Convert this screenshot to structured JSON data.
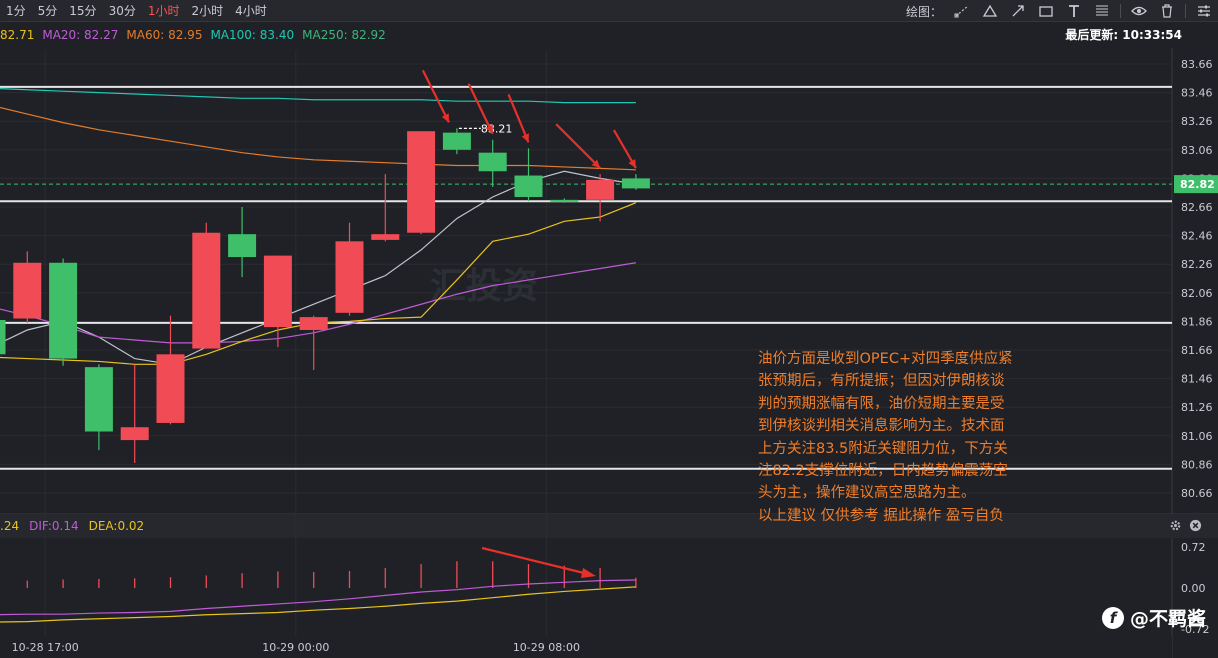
{
  "toolbar": {
    "timeframes": [
      "1分",
      "5分",
      "15分",
      "30分",
      "1小时",
      "2小时",
      "4小时"
    ],
    "active_index": 4,
    "draw_label": "绘图："
  },
  "ma_legend": [
    {
      "label": "82.71",
      "color": "#e8c31b"
    },
    {
      "label": "MA20: 82.27",
      "color": "#c05bd8"
    },
    {
      "label": "MA60: 82.95",
      "color": "#e57c2b"
    },
    {
      "label": "MA100: 83.40",
      "color": "#20c7b4"
    },
    {
      "label": "MA250: 82.92",
      "color": "#3fb47c"
    }
  ],
  "last_update": "最后更新: 10:33:54",
  "macd_legend": [
    {
      "label": ".24",
      "color": "#e8c31b"
    },
    {
      "label": "DIF:0.14",
      "color": "#c05bd8"
    },
    {
      "label": "DEA:0.02",
      "color": "#e8c31b"
    }
  ],
  "annotation_lines": [
    "油价方面是收到OPEC+对四季度供应紧",
    "张预期后，有所提振；但因对伊朗核谈",
    "判的预期涨幅有限，油价短期主要是受",
    "到伊核谈判相关消息影响为主。技术面",
    "上方关注83.5附近关键阻力位，下方关",
    "注82.2支撑位附近，日内趋势偏震荡空",
    "头为主，操作建议高空思路为主。",
    "以上建议 仅供参考 据此操作 盈亏自负"
  ],
  "logo_text": "@不羁酱",
  "chart_data": {
    "type": "candlestick",
    "price_axis": {
      "ticks": [
        83.66,
        83.46,
        83.26,
        83.06,
        82.86,
        82.66,
        82.46,
        82.26,
        82.06,
        81.86,
        81.66,
        81.46,
        81.26,
        81.06,
        80.86,
        80.66
      ],
      "current_price": 82.82,
      "high_label": "83.21"
    },
    "time_axis": {
      "labels": [
        {
          "label": "10-28 17:00",
          "index": 1.5
        },
        {
          "label": "10-29 00:00",
          "index": 8.5
        },
        {
          "label": "10-29 08:00",
          "index": 15.5
        }
      ]
    },
    "candles": [
      {
        "o": 81.63,
        "c": 81.87,
        "h": 81.95,
        "l": 81.55
      },
      {
        "o": 82.27,
        "c": 81.88,
        "h": 82.35,
        "l": 81.85
      },
      {
        "o": 81.6,
        "c": 82.27,
        "h": 82.3,
        "l": 81.55
      },
      {
        "o": 81.09,
        "c": 81.54,
        "h": 81.56,
        "l": 80.96
      },
      {
        "o": 81.12,
        "c": 81.03,
        "h": 81.56,
        "l": 80.87
      },
      {
        "o": 81.63,
        "c": 81.15,
        "h": 81.9,
        "l": 81.14
      },
      {
        "o": 82.48,
        "c": 81.67,
        "h": 82.55,
        "l": 81.67
      },
      {
        "o": 82.31,
        "c": 82.47,
        "h": 82.66,
        "l": 82.17
      },
      {
        "o": 82.32,
        "c": 81.82,
        "h": 82.32,
        "l": 81.68
      },
      {
        "o": 81.89,
        "c": 81.8,
        "h": 81.9,
        "l": 81.52
      },
      {
        "o": 82.42,
        "c": 81.92,
        "h": 82.55,
        "l": 81.9
      },
      {
        "o": 82.47,
        "c": 82.43,
        "h": 82.89,
        "l": 82.42
      },
      {
        "o": 83.19,
        "c": 82.48,
        "h": 83.19,
        "l": 82.47
      },
      {
        "o": 83.06,
        "c": 83.18,
        "h": 83.21,
        "l": 83.03
      },
      {
        "o": 82.91,
        "c": 83.04,
        "h": 83.13,
        "l": 82.8
      },
      {
        "o": 82.73,
        "c": 82.88,
        "h": 83.07,
        "l": 82.7
      },
      {
        "o": 82.71,
        "c": 82.71,
        "h": 82.72,
        "l": 82.69
      },
      {
        "o": 82.85,
        "c": 82.71,
        "h": 82.89,
        "l": 82.56
      },
      {
        "o": 82.79,
        "c": 82.86,
        "h": 82.89,
        "l": 82.78
      }
    ],
    "moving_averages": [
      {
        "name": "MA-short",
        "color": "#bfc3cc",
        "values": [
          81.68,
          81.8,
          81.86,
          81.75,
          81.6,
          81.56,
          81.68,
          81.78,
          81.88,
          81.98,
          82.08,
          82.18,
          82.36,
          82.58,
          82.73,
          82.84,
          82.91,
          82.86,
          82.82
        ]
      },
      {
        "name": "MA20",
        "color": "#c05bd8",
        "values": [
          81.96,
          81.9,
          81.83,
          81.75,
          81.73,
          81.71,
          81.71,
          81.72,
          81.74,
          81.78,
          81.84,
          81.91,
          81.98,
          82.05,
          82.11,
          82.15,
          82.19,
          82.23,
          82.27
        ]
      },
      {
        "name": "MA60",
        "color": "#e57c2b",
        "values": [
          83.37,
          83.31,
          83.25,
          83.2,
          83.16,
          83.12,
          83.08,
          83.04,
          83.01,
          82.99,
          82.98,
          82.97,
          82.96,
          82.95,
          82.95,
          82.95,
          82.94,
          82.93,
          82.92
        ]
      },
      {
        "name": "MA100",
        "color": "#20c7b4",
        "values": [
          83.49,
          83.48,
          83.47,
          83.46,
          83.45,
          83.44,
          83.43,
          83.42,
          83.42,
          83.41,
          83.41,
          83.41,
          83.41,
          83.4,
          83.4,
          83.4,
          83.39,
          83.39,
          83.39
        ]
      },
      {
        "name": "MA-yellow",
        "color": "#e8c31b",
        "values": [
          81.61,
          81.6,
          81.59,
          81.58,
          81.56,
          81.56,
          81.63,
          81.72,
          81.8,
          81.85,
          81.86,
          81.88,
          81.89,
          82.15,
          82.42,
          82.47,
          82.56,
          82.59,
          82.69
        ]
      }
    ],
    "horizontal_levels": [
      83.5,
      82.7,
      81.85,
      80.83
    ],
    "macd": {
      "ticks": [
        0.72,
        0.0,
        -0.72
      ],
      "hist": [
        0.14,
        0.13,
        0.15,
        0.16,
        0.17,
        0.19,
        0.22,
        0.26,
        0.29,
        0.28,
        0.3,
        0.35,
        0.42,
        0.47,
        0.47,
        0.42,
        0.39,
        0.35,
        0.18
      ],
      "dif": [
        -0.47,
        -0.46,
        -0.46,
        -0.44,
        -0.43,
        -0.41,
        -0.36,
        -0.32,
        -0.28,
        -0.24,
        -0.19,
        -0.13,
        -0.07,
        -0.03,
        0.03,
        0.07,
        0.1,
        0.13,
        0.14
      ],
      "dea": [
        -0.6,
        -0.59,
        -0.56,
        -0.54,
        -0.52,
        -0.5,
        -0.47,
        -0.45,
        -0.43,
        -0.39,
        -0.36,
        -0.32,
        -0.27,
        -0.23,
        -0.17,
        -0.11,
        -0.06,
        -0.02,
        0.02
      ]
    },
    "watermark": "汇投资"
  }
}
